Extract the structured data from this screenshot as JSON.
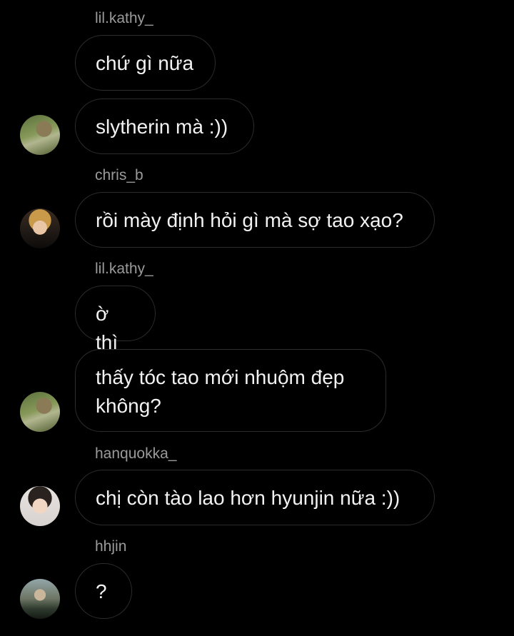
{
  "messages": [
    {
      "sender": "lil.kathy_",
      "text": "chứ gì nữa"
    },
    {
      "text": "slytherin mà :))",
      "avatar": "avatar-lil-kathy"
    },
    {
      "sender": "chris_b",
      "text": "rồi mày định hỏi gì mà sợ tao xạo?",
      "avatar": "avatar-chris-b"
    },
    {
      "sender": "lil.kathy_",
      "text": "ờ thì"
    },
    {
      "text_line1": "thấy tóc tao mới nhuộm đẹp",
      "text_line2": "không?",
      "avatar": "avatar-lil-kathy"
    },
    {
      "sender": "hanquokka_",
      "text": "chị còn tào lao hơn hyunjin nữa :))",
      "avatar": "avatar-hanquokka"
    },
    {
      "sender": "hhjin",
      "text": "?",
      "avatar": "avatar-hhjin"
    }
  ],
  "colors": {
    "background": "#000000",
    "bubble_border": "#2c2c2c",
    "sender": "#9a9a9a",
    "text": "#f2f2f2"
  }
}
